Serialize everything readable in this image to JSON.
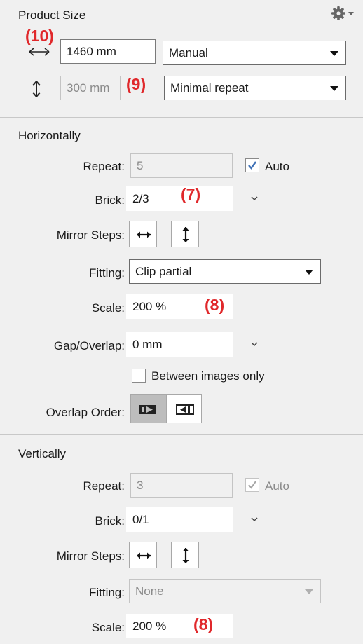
{
  "product_size": {
    "title": "Product Size",
    "width_value": "1460 mm",
    "width_mode": "Manual",
    "height_value": "300 mm",
    "height_mode": "Minimal repeat"
  },
  "annotations": {
    "a10": "(10)",
    "a9": "(9)",
    "a7": "(7)",
    "a8_h": "(8)",
    "a8_v": "(8)"
  },
  "horizontally": {
    "title": "Horizontally",
    "repeat_label": "Repeat:",
    "repeat_value": "5",
    "auto_label": "Auto",
    "auto_checked": true,
    "brick_label": "Brick:",
    "brick_value": "2/3",
    "mirror_label": "Mirror Steps:",
    "fitting_label": "Fitting:",
    "fitting_value": "Clip partial",
    "scale_label": "Scale:",
    "scale_value": "200 %",
    "gap_label": "Gap/Overlap:",
    "gap_value": "0 mm",
    "between_label": "Between images only",
    "between_checked": false,
    "overlap_order_label": "Overlap Order:"
  },
  "vertically": {
    "title": "Vertically",
    "repeat_label": "Repeat:",
    "repeat_value": "3",
    "auto_label": "Auto",
    "auto_checked": true,
    "brick_label": "Brick:",
    "brick_value": "0/1",
    "mirror_label": "Mirror Steps:",
    "fitting_label": "Fitting:",
    "fitting_value": "None",
    "scale_label": "Scale:",
    "scale_value": "200 %"
  },
  "colors": {
    "annotation": "#e0282b",
    "panel_bg": "#f0f0f0",
    "checkbox_check": "#3c6fb5"
  }
}
